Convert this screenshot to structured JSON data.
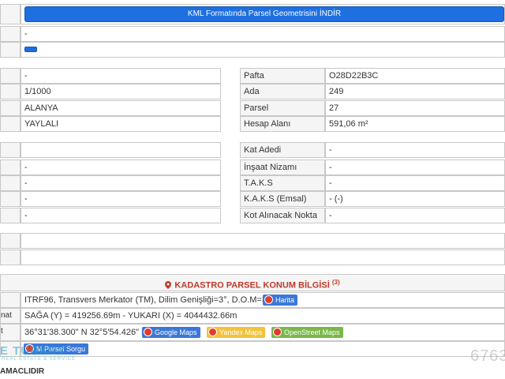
{
  "top": {
    "kml_button": "KML Formatında Parsel Geometrisini İNDİR",
    "dash_value": "-"
  },
  "parcel_left": {
    "rows": [
      "-",
      "1/1000",
      "ALANYA",
      "YAYLALI"
    ]
  },
  "parcel_right": {
    "rows": [
      {
        "label": "Pafta",
        "value": "O28D22B3C"
      },
      {
        "label": "Ada",
        "value": "249"
      },
      {
        "label": "Parsel",
        "value": "27"
      },
      {
        "label": "Hesap Alanı",
        "value": "591,06 m²"
      }
    ]
  },
  "zoning_left": {
    "rows": [
      "",
      "-",
      "-",
      "-",
      "-"
    ]
  },
  "zoning_right": {
    "rows": [
      {
        "label": "Kat Adedi",
        "value": "-"
      },
      {
        "label": "İnşaat Nizamı",
        "value": "-"
      },
      {
        "label": "T.A.K.S",
        "value": "-"
      },
      {
        "label": "K.A.K.S (Emsal)",
        "value": "- (-)"
      },
      {
        "label": "Kot Alınacak Nokta",
        "value": "-"
      }
    ]
  },
  "location": {
    "title": "KADASTRO PARSEL KONUM BİLGİSİ",
    "title_sup": "(3)",
    "projection_text": "ITRF96, Transvers Merkator (TM), Dilim Genişliği=3°, D.O.M=33°",
    "harita_button": "Harita",
    "coord_label_partial": "nat",
    "coord_text": "SAĞA (Y) = 419256.69m - YUKARI (X) = 4044432.66m",
    "geo_label_partial": "t",
    "geo_text": "36°31'38.300\" N 32°5'54.426\" E",
    "google_maps": "Google Maps",
    "yandex_maps": "Yandex Maps",
    "osm_maps": "OpenStreet Maps",
    "sorgu_button": "M Parsel Sorgu",
    "amaclidir": "AMACLIDIR"
  },
  "watermark": {
    "brand": "E TURKEY",
    "tagline": "REAL ESTATE & SERVICE",
    "number": "6763"
  },
  "colors": {
    "button_blue": "#1e6fe0",
    "pin_red": "#e03c2e",
    "google_blue": "#3a78d8",
    "yandex_yellow": "#f3c23a",
    "osm_green": "#79b849"
  }
}
